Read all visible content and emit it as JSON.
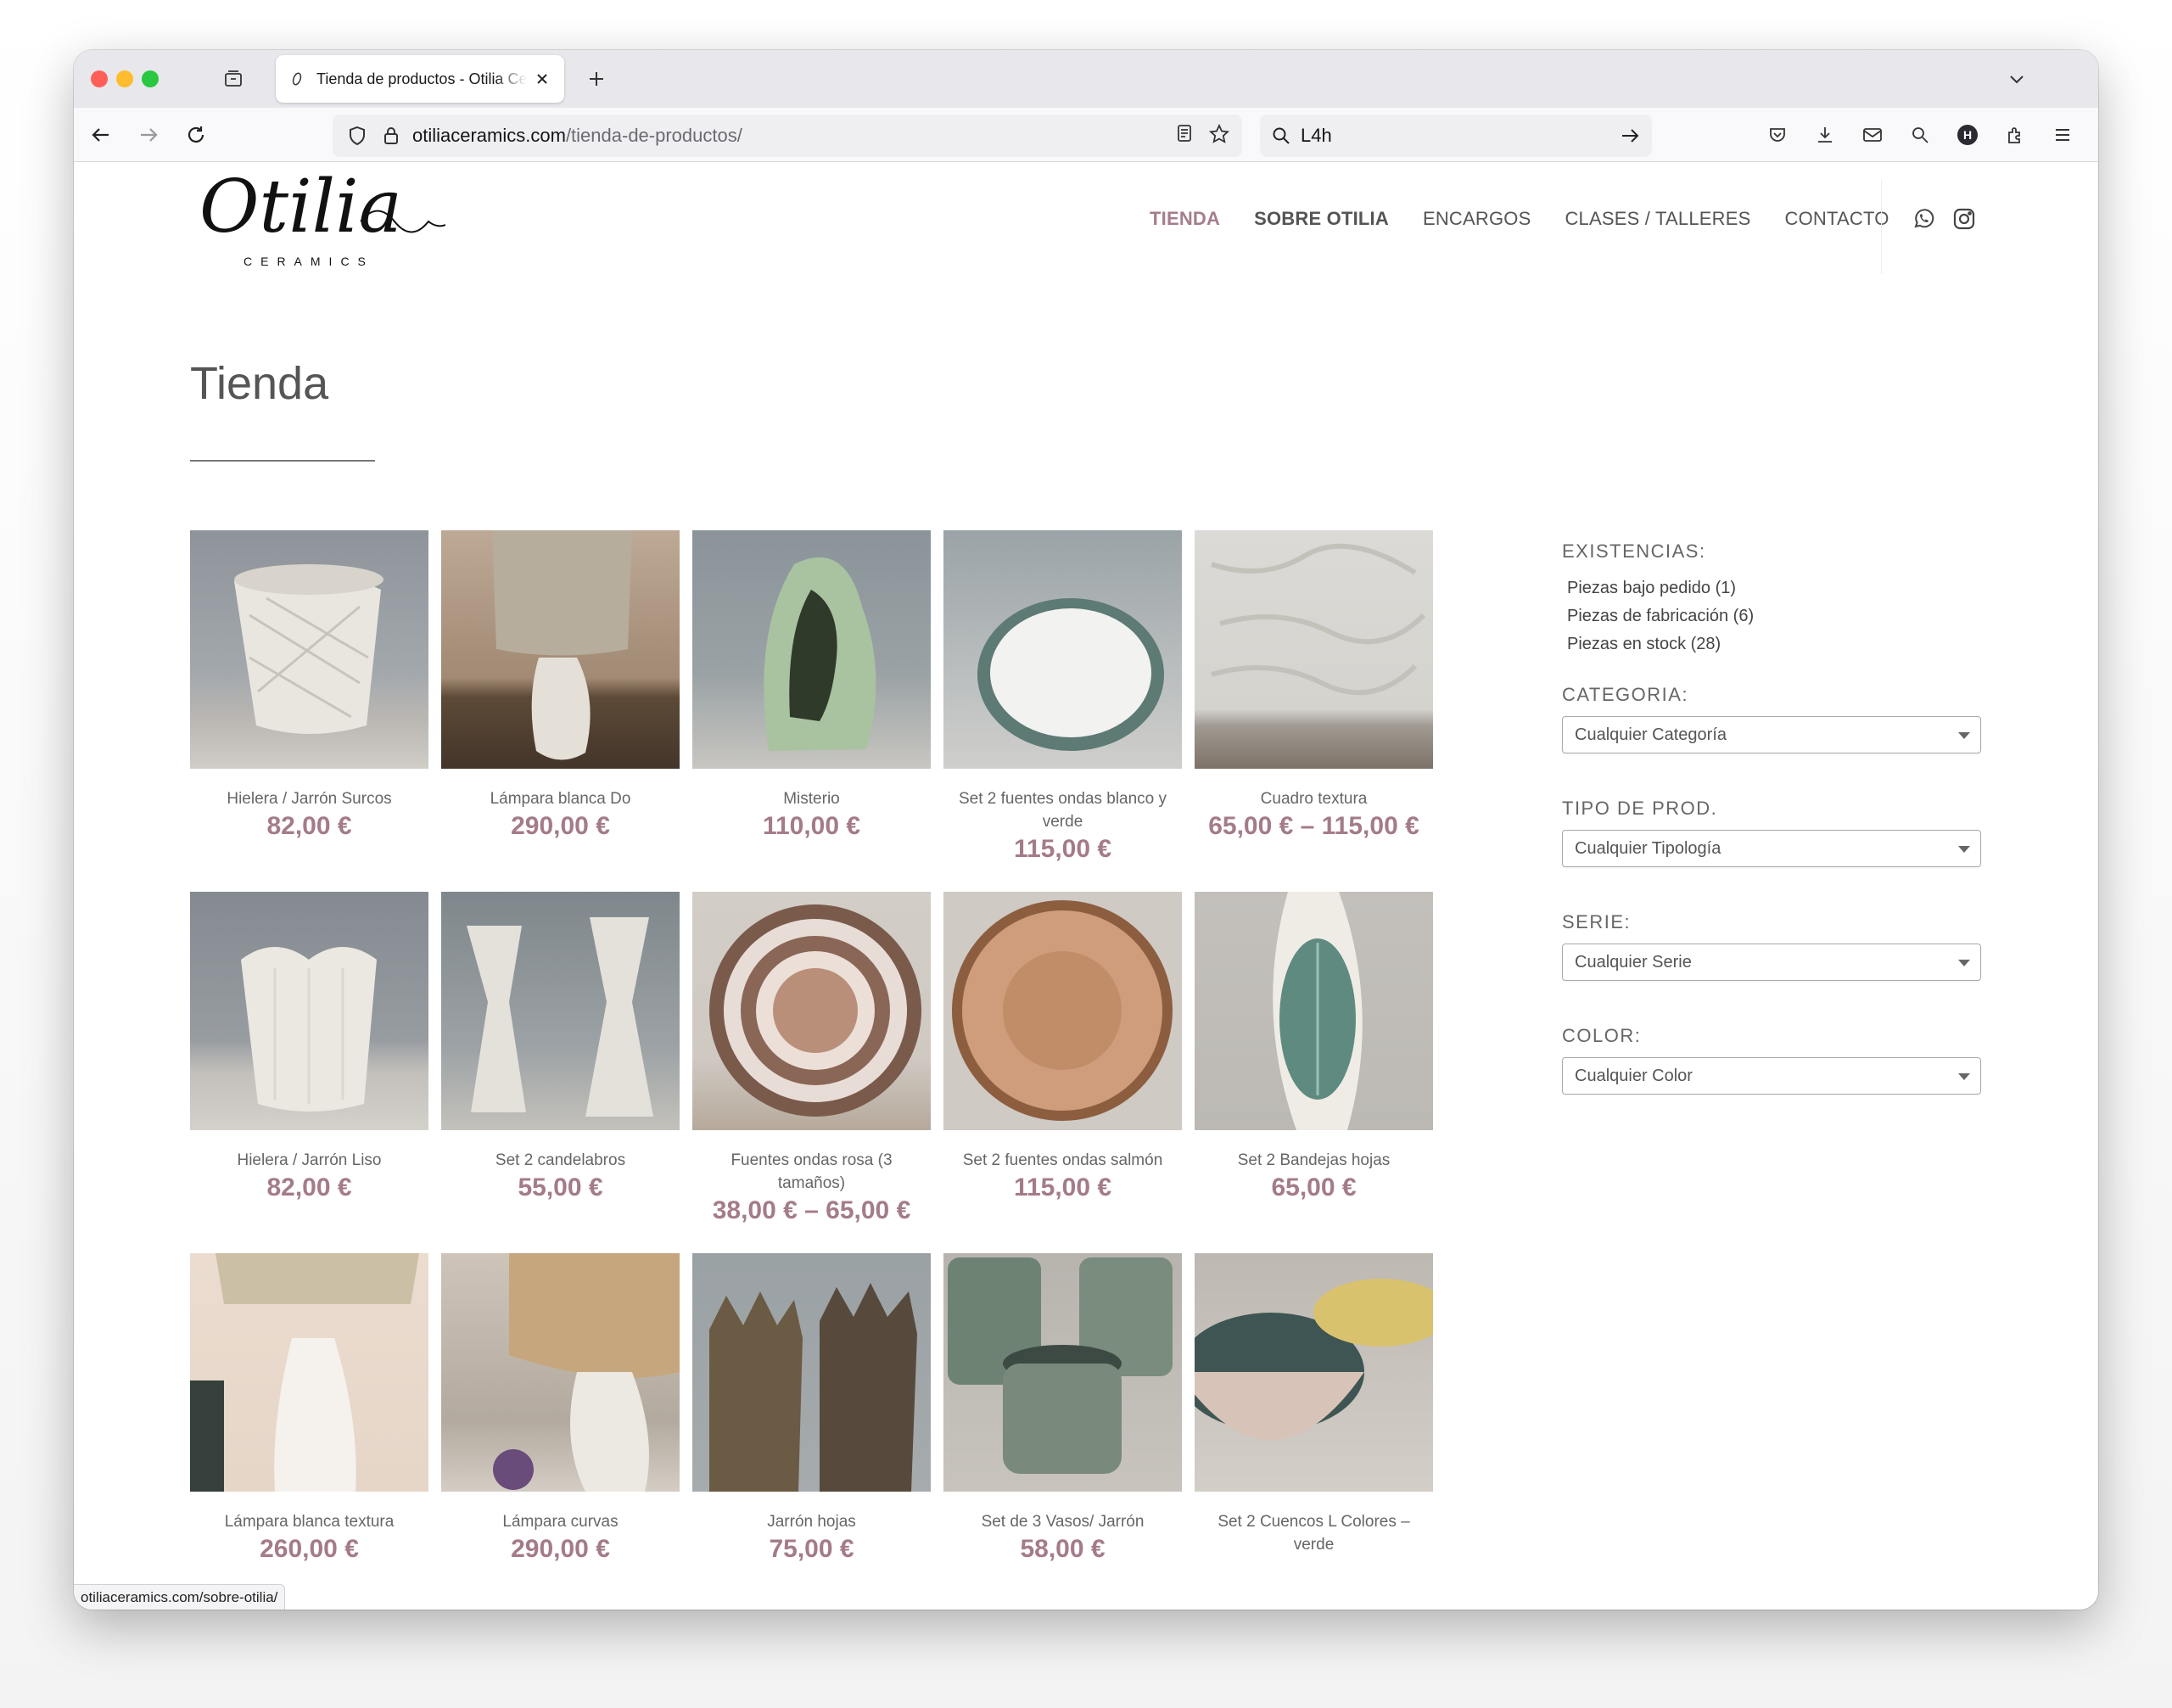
{
  "browser": {
    "tab_title": "Tienda de productos - Otilia Ceramics",
    "url_host": "otiliaceramics.com",
    "url_path": "/tienda-de-productos/",
    "search_value": "L4h",
    "account_initial": "H",
    "status_url": "otiliaceramics.com/sobre-otilia/"
  },
  "site": {
    "nav": [
      {
        "label": "TIENDA"
      },
      {
        "label": "SOBRE OTILIA"
      },
      {
        "label": "ENCARGOS"
      },
      {
        "label": "CLASES / TALLERES"
      },
      {
        "label": "CONTACTO"
      }
    ],
    "brand_color": "#a47b8a",
    "logo_text": "Otilia",
    "logo_sub": "CERAMICS"
  },
  "page": {
    "title": "Tienda"
  },
  "products": [
    {
      "name": "Hielera / Jarrón Surcos",
      "price": "82,00 €"
    },
    {
      "name": "Lámpara blanca Do",
      "price": "290,00 €"
    },
    {
      "name": "Misterio",
      "price": "110,00 €"
    },
    {
      "name": "Set 2 fuentes ondas blanco y verde",
      "price": "115,00 €"
    },
    {
      "name": "Cuadro textura",
      "price": "65,00 € – 115,00 €"
    },
    {
      "name": "Hielera / Jarrón Liso",
      "price": "82,00 €"
    },
    {
      "name": "Set 2 candelabros",
      "price": "55,00 €"
    },
    {
      "name": "Fuentes ondas rosa (3 tamaños)",
      "price": "38,00 € – 65,00 €"
    },
    {
      "name": "Set 2 fuentes ondas salmón",
      "price": "115,00 €"
    },
    {
      "name": "Set 2 Bandejas hojas",
      "price": "65,00 €"
    },
    {
      "name": "Lámpara blanca textura",
      "price": "260,00 €"
    },
    {
      "name": "Lámpara curvas",
      "price": "290,00 €"
    },
    {
      "name": "Jarrón hojas",
      "price": "75,00 €"
    },
    {
      "name": "Set de 3 Vasos/ Jarrón",
      "price": "58,00 €"
    },
    {
      "name": "Set 2 Cuencos L Colores – verde",
      "price": ""
    }
  ],
  "sidebar": {
    "existencias_title": "EXISTENCIAS:",
    "stock": [
      {
        "label": "Piezas bajo pedido (1)"
      },
      {
        "label": "Piezas de fabricación (6)"
      },
      {
        "label": "Piezas en stock (28)"
      }
    ],
    "filters": [
      {
        "title": "CATEGORIA:",
        "value": "Cualquier Categoría"
      },
      {
        "title": "TIPO DE PROD.",
        "value": "Cualquier Tipología"
      },
      {
        "title": "SERIE:",
        "value": "Cualquier Serie"
      },
      {
        "title": "COLOR:",
        "value": "Cualquier Color"
      }
    ]
  }
}
